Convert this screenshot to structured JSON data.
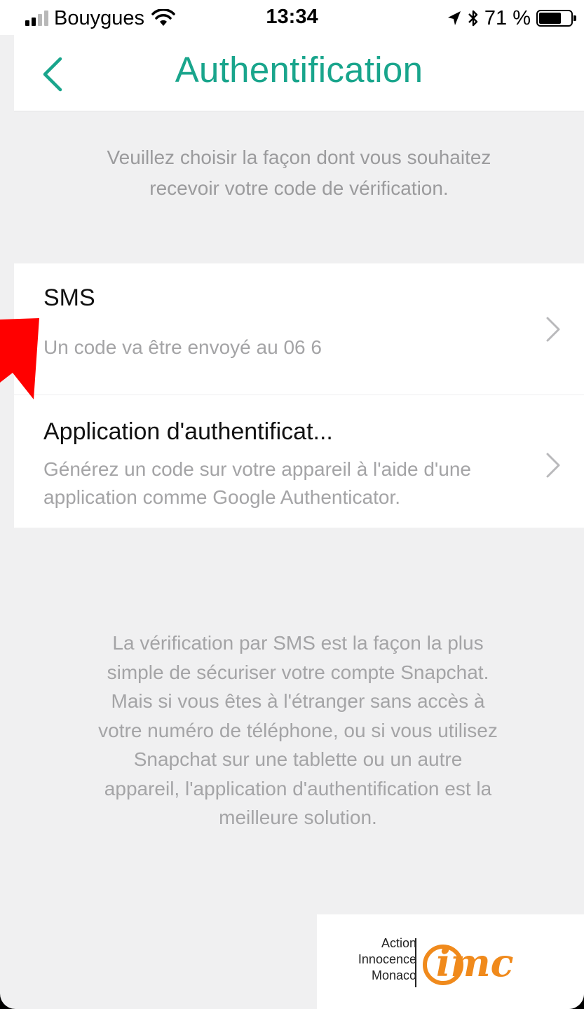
{
  "status_bar": {
    "carrier": "Bouygues",
    "time": "13:34",
    "battery_percent": "71 %",
    "battery_level": 0.71,
    "signal_bars_filled": 2,
    "signal_bars_total": 4
  },
  "header": {
    "title": "Authentification",
    "back_icon": "chevron-left-icon"
  },
  "intro": {
    "line1": "Veuillez choisir la façon dont vous souhaitez",
    "line2": "recevoir votre code de vérification."
  },
  "options": [
    {
      "title": "SMS",
      "description": "Un code va être envoyé au 06 6"
    },
    {
      "title": "Application d'authentificat...",
      "description_line1": "Générez un code sur votre appareil à l'aide d'une",
      "description_line2": "application comme Google Authenticator."
    }
  ],
  "footer": {
    "lines": [
      "La vérification par SMS est la façon la plus",
      "simple de sécuriser votre compte Snapchat.",
      "Mais si vous êtes à l'étranger sans accès à",
      "votre numéro de téléphone, ou si vous utilisez",
      "Snapchat sur une tablette ou un autre",
      "appareil, l'application d'authentification est la",
      "meilleure solution."
    ]
  },
  "watermark": {
    "line1": "Action",
    "line2": "Innocence",
    "line3": "Monaco",
    "logo_text": "@imc"
  },
  "colors": {
    "accent": "#19a58c",
    "annotation": "#ff0000",
    "logo": "#f08a1c"
  }
}
